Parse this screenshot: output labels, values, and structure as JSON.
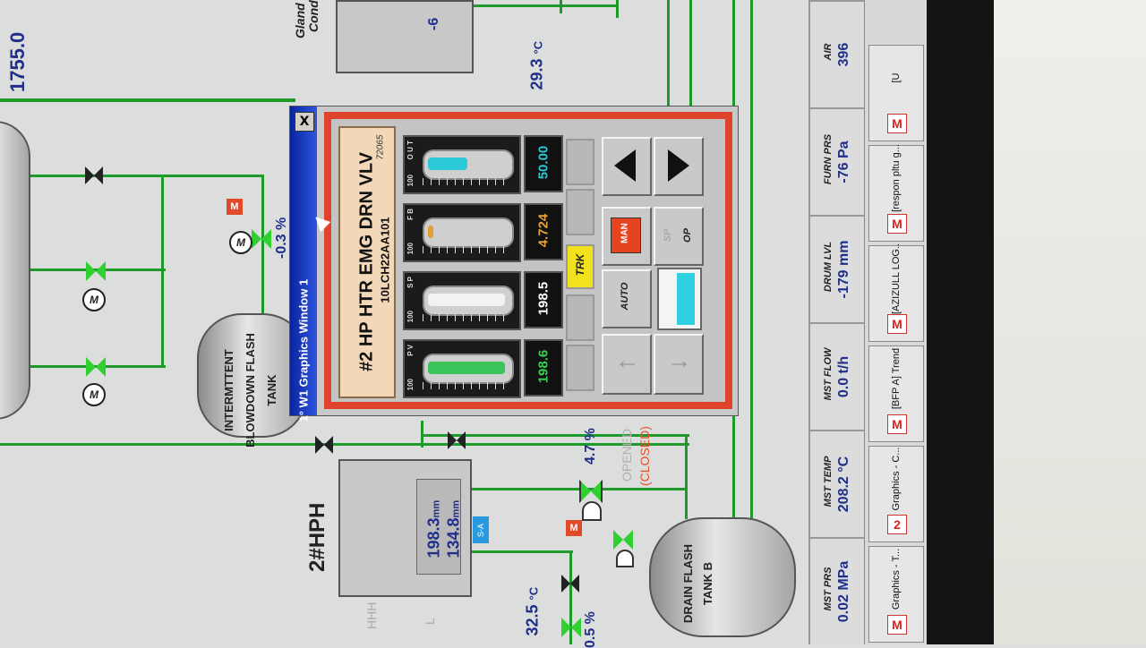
{
  "popup": {
    "title": "W1 Graphics Window 1",
    "title_index": "1",
    "close_label": "X",
    "tag_description": "#2 HP HTR EMG DRN VLV",
    "tag_id": "10LCH22AA101",
    "tag_number": "72065",
    "bars": [
      {
        "label": "P V",
        "scale_max": "100",
        "fill_fraction": 0.98,
        "color": "#3ac45a"
      },
      {
        "label": "S P",
        "scale_max": "100",
        "fill_fraction": 0.98,
        "color": "#f2f2f2"
      },
      {
        "label": "F B",
        "scale_max": "100",
        "fill_fraction": 0.05,
        "color": "#e0a030"
      },
      {
        "label": "O U T",
        "scale_max": "100",
        "fill_fraction": 0.5,
        "color": "#2bc8d8"
      }
    ],
    "values": [
      {
        "text": "198.6",
        "color": "#3ad050"
      },
      {
        "text": "198.5",
        "color": "#ffffff"
      },
      {
        "text": "4.724",
        "color": "#e6a03a"
      },
      {
        "text": "50.00",
        "color": "#2ec6d6"
      }
    ],
    "trk_label": "TRK",
    "man_label": "MAN",
    "auto_label": "AUTO",
    "sp_label": "SP",
    "op_label": "OP",
    "output_fraction": 0.5
  },
  "process": {
    "left_top_value": "1755.0",
    "top_pct": "-0.3 %",
    "temp_top": "29.3",
    "temp_unit": "°C",
    "gland_label": "Gland",
    "gland_label2": "Cond",
    "top_box_value": "-6",
    "vessel_flash_tank": "INTERMTTENT BLOWDOWN FLASH TANK",
    "hph_label": "2#HPH",
    "hph_value_1": "198.3",
    "hph_value_2": "134.8",
    "hph_unit": "mm",
    "hph_tag": "S-A",
    "valve_pct": "4.7 %",
    "opened_label": "OPENED",
    "closed_label": "(CLOSED)",
    "temp_bottom": "32.5",
    "bottom_pct": "0.5 %",
    "drain_tank": "DRAIN FLASH TANK B",
    "hhh_label": "HHH",
    "l_label": "L",
    "motor_label": "M",
    "m_icon_label": "M"
  },
  "status": [
    {
      "label": "MST PRS",
      "value": "0.02",
      "unit": "MPa"
    },
    {
      "label": "MST TEMP",
      "value": "208.2",
      "unit": "°C"
    },
    {
      "label": "MST FLOW",
      "value": "0.0",
      "unit": "t/h"
    },
    {
      "label": "DRUM LVL",
      "value": "-179",
      "unit": "mm"
    },
    {
      "label": "FURN PRS",
      "value": "-76",
      "unit": "Pa"
    },
    {
      "label": "AIR",
      "value": "396",
      "unit": ""
    }
  ],
  "taskbar": [
    "Graphics - T...",
    "Graphics - C...",
    "[BFP A] Trend",
    "[AZIZULL LOG...",
    "[respon pltu g...",
    "[U"
  ],
  "taskbar_badge": "2",
  "colors": {
    "pipe": "#1e9a2c",
    "popup_frame": "#e0432b",
    "title_bar": "#0a24a0",
    "value_text": "#1f2f8a"
  }
}
